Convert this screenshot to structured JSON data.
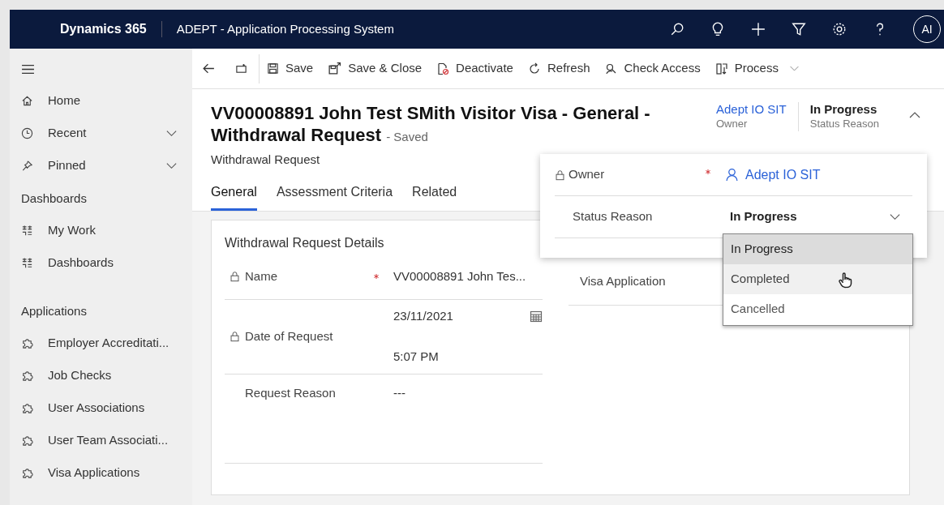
{
  "topbar": {
    "brand": "Dynamics 365",
    "app_title": "ADEPT - Application Processing System",
    "avatar": "AI"
  },
  "commands": [
    {
      "kind": "back"
    },
    {
      "kind": "popout"
    },
    {
      "label": "Save"
    },
    {
      "label": "Save & Close"
    },
    {
      "label": "Deactivate"
    },
    {
      "label": "Refresh"
    },
    {
      "label": "Check Access"
    },
    {
      "label": "Process"
    }
  ],
  "sidebar": {
    "items": [
      {
        "kind": "nav",
        "label": "Home"
      },
      {
        "kind": "nav",
        "label": "Recent",
        "expanded": false
      },
      {
        "kind": "nav",
        "label": "Pinned",
        "expanded": false
      },
      {
        "kind": "heading",
        "label": "Dashboards"
      },
      {
        "kind": "nav",
        "label": "My Work"
      },
      {
        "kind": "nav",
        "label": "Dashboards"
      },
      {
        "kind": "heading",
        "label": "Applications"
      },
      {
        "kind": "nav",
        "label": "Employer Accreditati..."
      },
      {
        "kind": "nav",
        "label": "Job Checks"
      },
      {
        "kind": "nav",
        "label": "User Associations"
      },
      {
        "kind": "nav",
        "label": "User Team Associati..."
      },
      {
        "kind": "nav",
        "label": "Visa Applications"
      }
    ]
  },
  "record": {
    "title": "VV00008891 John Test SMith Visitor Visa - General - Withdrawal Request",
    "save_state": "- Saved",
    "entity": "Withdrawal Request",
    "header_fields": [
      {
        "kind": "link",
        "value": "Adept IO SIT",
        "label": "Owner"
      },
      {
        "kind": "text",
        "value": "In Progress",
        "label": "Status Reason"
      }
    ],
    "header_expanded": true
  },
  "tabs": [
    {
      "label": "General",
      "selected": true
    },
    {
      "label": "Assessment Criteria",
      "selected": false
    },
    {
      "label": "Related",
      "selected": false
    }
  ],
  "flyout": {
    "owner": {
      "label": "Owner",
      "locked": true,
      "required": true,
      "value": "Adept IO SIT"
    },
    "status": {
      "label": "Status Reason",
      "value": "In Progress"
    },
    "options": [
      {
        "label": "In Progress",
        "selected": true,
        "hovered": false
      },
      {
        "label": "Completed",
        "selected": false,
        "hovered": true
      },
      {
        "label": "Cancelled",
        "selected": false,
        "hovered": false
      }
    ]
  },
  "section": {
    "title": "Withdrawal Request Details",
    "fields": [
      {
        "kind": "text",
        "label": "Name",
        "locked": true,
        "required": true,
        "value": "VV00008891 John Tes..."
      },
      {
        "kind": "datetime",
        "label": "Date of Request",
        "locked": true,
        "required": false,
        "date": "23/11/2021",
        "time": "5:07 PM"
      },
      {
        "kind": "text",
        "label": "Request Reason",
        "locked": false,
        "required": false,
        "value": "---"
      }
    ],
    "right_fields": [
      {
        "label": "Visa Application"
      }
    ]
  }
}
